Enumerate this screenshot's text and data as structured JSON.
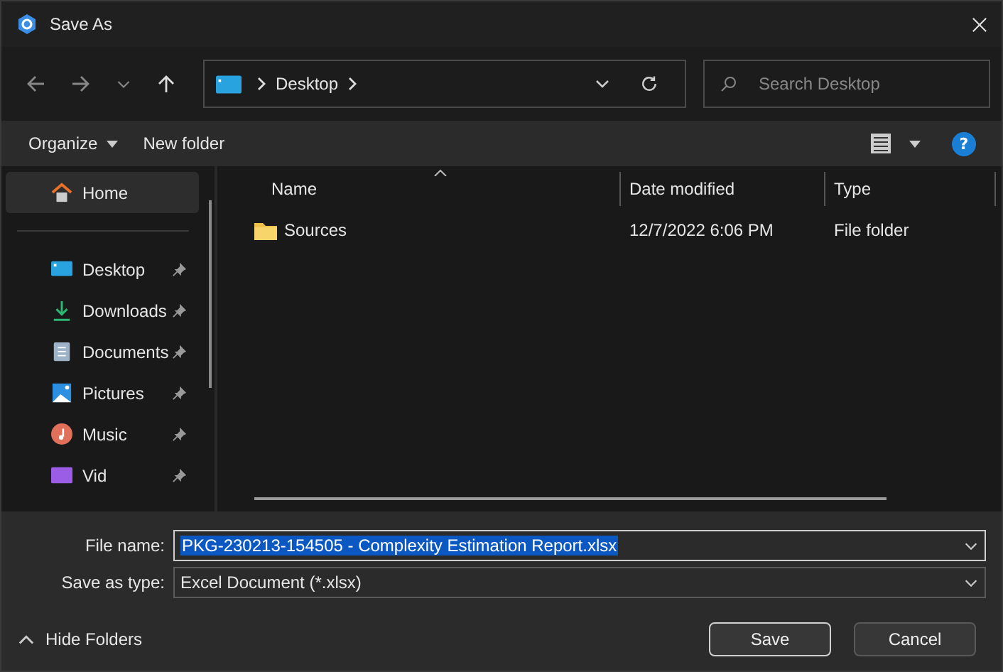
{
  "window": {
    "title": "Save As"
  },
  "address": {
    "crumbs": [
      "Desktop"
    ]
  },
  "search": {
    "placeholder": "Search Desktop"
  },
  "toolbar": {
    "organize": "Organize",
    "new_folder": "New folder",
    "help": "?"
  },
  "sidebar": {
    "items": [
      {
        "label": "Home",
        "kind": "home",
        "selected": true,
        "pinned": false
      },
      {
        "label": "Desktop",
        "kind": "desktop",
        "selected": false,
        "pinned": true
      },
      {
        "label": "Downloads",
        "kind": "downloads",
        "selected": false,
        "pinned": true
      },
      {
        "label": "Documents",
        "kind": "documents",
        "selected": false,
        "pinned": true
      },
      {
        "label": "Pictures",
        "kind": "pictures",
        "selected": false,
        "pinned": true
      },
      {
        "label": "Music",
        "kind": "music",
        "selected": false,
        "pinned": true
      },
      {
        "label": "Vid",
        "kind": "videos",
        "selected": false,
        "pinned": true
      }
    ]
  },
  "table": {
    "columns": [
      "Name",
      "Date modified",
      "Type"
    ],
    "rows": [
      {
        "name": "Sources",
        "date": "12/7/2022 6:06 PM",
        "type": "File folder"
      }
    ]
  },
  "form": {
    "file_name_label": "File name:",
    "file_name": "PKG-230213-154505 - Complexity Estimation Report.xlsx",
    "type_label": "Save as type:",
    "type": "Excel Document  (*.xlsx)"
  },
  "footer": {
    "hide_folders": "Hide Folders",
    "buttons": [
      "Save",
      "Cancel"
    ]
  }
}
